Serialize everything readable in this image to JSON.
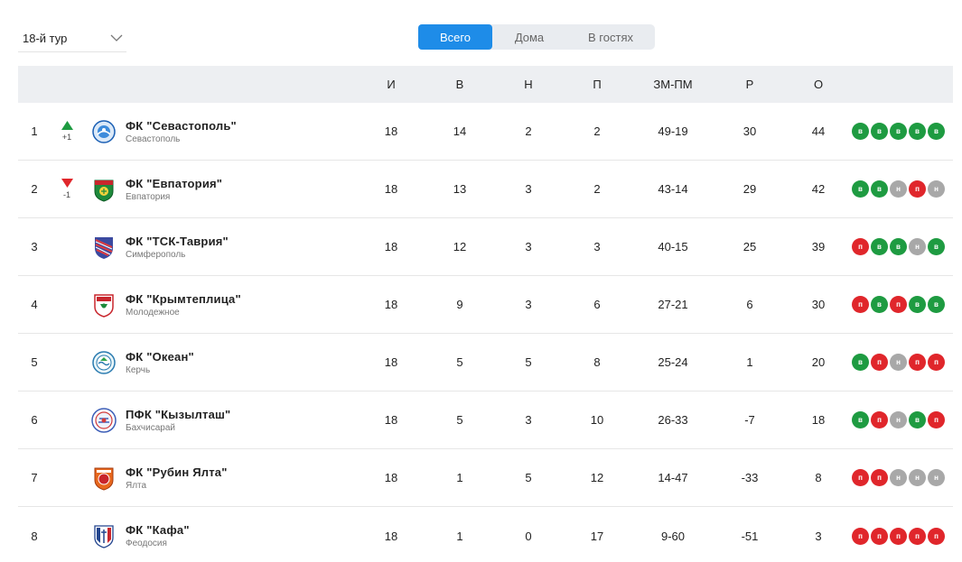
{
  "round_select": {
    "value": "18-й тур"
  },
  "tabs": [
    {
      "label": "Всего",
      "active": true
    },
    {
      "label": "Дома",
      "active": false
    },
    {
      "label": "В гостях",
      "active": false
    }
  ],
  "headers": {
    "played": "И",
    "won": "В",
    "drawn": "Н",
    "lost": "П",
    "goals": "ЗМ-ПМ",
    "diff": "Р",
    "points": "О"
  },
  "colors": {
    "accent": "#1e8ce8",
    "win": "#1e9b41",
    "loss": "#e0262b",
    "draw": "#a8a8a8",
    "up": "#1e9b41",
    "down": "#e0262b"
  },
  "rows": [
    {
      "pos": "1",
      "trend": "up",
      "change": "+1",
      "logo": "sevastopol-logo",
      "name": "ФК \"Севастополь\"",
      "city": "Севастополь",
      "played": "18",
      "won": "14",
      "drawn": "2",
      "lost": "2",
      "goals": "49-19",
      "diff": "30",
      "points": "44",
      "form": [
        {
          "r": "w",
          "t": "в"
        },
        {
          "r": "w",
          "t": "в"
        },
        {
          "r": "w",
          "t": "в"
        },
        {
          "r": "w",
          "t": "в"
        },
        {
          "r": "w",
          "t": "в"
        }
      ]
    },
    {
      "pos": "2",
      "trend": "down",
      "change": "-1",
      "logo": "evpatoria-logo",
      "name": "ФК \"Евпатория\"",
      "city": "Евпатория",
      "played": "18",
      "won": "13",
      "drawn": "3",
      "lost": "2",
      "goals": "43-14",
      "diff": "29",
      "points": "42",
      "form": [
        {
          "r": "w",
          "t": "в"
        },
        {
          "r": "w",
          "t": "в"
        },
        {
          "r": "d",
          "t": "н"
        },
        {
          "r": "l",
          "t": "п"
        },
        {
          "r": "d",
          "t": "н"
        }
      ]
    },
    {
      "pos": "3",
      "trend": "",
      "change": "",
      "logo": "tsk-tavria-logo",
      "name": "ФК \"ТСК-Таврия\"",
      "city": "Симферополь",
      "played": "18",
      "won": "12",
      "drawn": "3",
      "lost": "3",
      "goals": "40-15",
      "diff": "25",
      "points": "39",
      "form": [
        {
          "r": "l",
          "t": "п"
        },
        {
          "r": "w",
          "t": "в"
        },
        {
          "r": "w",
          "t": "в"
        },
        {
          "r": "d",
          "t": "н"
        },
        {
          "r": "w",
          "t": "в"
        }
      ]
    },
    {
      "pos": "4",
      "trend": "",
      "change": "",
      "logo": "krymteplitsa-logo",
      "name": "ФК \"Крымтеплица\"",
      "city": "Молодежное",
      "played": "18",
      "won": "9",
      "drawn": "3",
      "lost": "6",
      "goals": "27-21",
      "diff": "6",
      "points": "30",
      "form": [
        {
          "r": "l",
          "t": "п"
        },
        {
          "r": "w",
          "t": "в"
        },
        {
          "r": "l",
          "t": "п"
        },
        {
          "r": "w",
          "t": "в"
        },
        {
          "r": "w",
          "t": "в"
        }
      ]
    },
    {
      "pos": "5",
      "trend": "",
      "change": "",
      "logo": "okean-logo",
      "name": "ФК \"Океан\"",
      "city": "Керчь",
      "played": "18",
      "won": "5",
      "drawn": "5",
      "lost": "8",
      "goals": "25-24",
      "diff": "1",
      "points": "20",
      "form": [
        {
          "r": "w",
          "t": "в"
        },
        {
          "r": "l",
          "t": "п"
        },
        {
          "r": "d",
          "t": "н"
        },
        {
          "r": "l",
          "t": "п"
        },
        {
          "r": "l",
          "t": "п"
        }
      ]
    },
    {
      "pos": "6",
      "trend": "",
      "change": "",
      "logo": "kyzyltash-logo",
      "name": "ПФК \"Кызылташ\"",
      "city": "Бахчисарай",
      "played": "18",
      "won": "5",
      "drawn": "3",
      "lost": "10",
      "goals": "26-33",
      "diff": "-7",
      "points": "18",
      "form": [
        {
          "r": "w",
          "t": "в"
        },
        {
          "r": "l",
          "t": "п"
        },
        {
          "r": "d",
          "t": "н"
        },
        {
          "r": "w",
          "t": "в"
        },
        {
          "r": "l",
          "t": "п"
        }
      ]
    },
    {
      "pos": "7",
      "trend": "",
      "change": "",
      "logo": "rubin-yalta-logo",
      "name": "ФК \"Рубин Ялта\"",
      "city": "Ялта",
      "played": "18",
      "won": "1",
      "drawn": "5",
      "lost": "12",
      "goals": "14-47",
      "diff": "-33",
      "points": "8",
      "form": [
        {
          "r": "l",
          "t": "п"
        },
        {
          "r": "l",
          "t": "п"
        },
        {
          "r": "d",
          "t": "н"
        },
        {
          "r": "d",
          "t": "н"
        },
        {
          "r": "d",
          "t": "н"
        }
      ]
    },
    {
      "pos": "8",
      "trend": "",
      "change": "",
      "logo": "kafa-logo",
      "name": "ФК \"Кафа\"",
      "city": "Феодосия",
      "played": "18",
      "won": "1",
      "drawn": "0",
      "lost": "17",
      "goals": "9-60",
      "diff": "-51",
      "points": "3",
      "form": [
        {
          "r": "l",
          "t": "п"
        },
        {
          "r": "l",
          "t": "п"
        },
        {
          "r": "l",
          "t": "п"
        },
        {
          "r": "l",
          "t": "п"
        },
        {
          "r": "l",
          "t": "п"
        }
      ]
    }
  ]
}
